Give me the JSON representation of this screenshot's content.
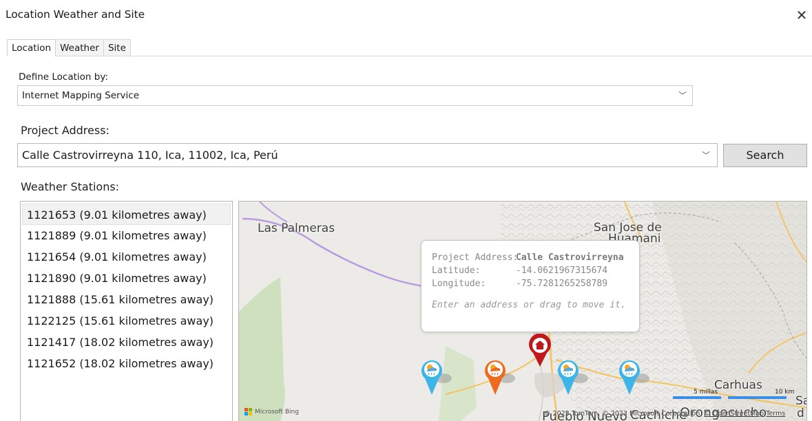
{
  "window": {
    "title": "Location Weather and Site",
    "close_glyph": "✕"
  },
  "tabs": [
    {
      "label": "Location",
      "active": true
    },
    {
      "label": "Weather",
      "active": false
    },
    {
      "label": "Site",
      "active": false
    }
  ],
  "define_location": {
    "label": "Define Location by:",
    "value": "Internet Mapping Service"
  },
  "project_address": {
    "label": "Project Address:",
    "value": "Calle Castrovirreyna 110, Ica, 11002, Ica, Perú"
  },
  "search_button": "Search",
  "weather_stations": {
    "label": "Weather Stations:",
    "items": [
      "1121653 (9.01 kilometres away)",
      "1121889 (9.01 kilometres away)",
      "1121654 (9.01 kilometres away)",
      "1121890 (9.01 kilometres away)",
      "1121888 (15.61 kilometres away)",
      "1122125 (15.61 kilometres away)",
      "1121417 (18.02 kilometres away)",
      "1121652 (18.02 kilometres away)"
    ],
    "selected_index": 0
  },
  "map": {
    "places": {
      "las_palmeras": "Las Palmeras",
      "san_jose_1": "San Jose de",
      "san_jose_2": "Huamani",
      "carhuas": "Carhuas",
      "orongocucho": "Orongocucho",
      "pueblo_nuevo": "Pueblo Nuevo",
      "cachiche": "Cachiche",
      "sa": "Sa",
      "d": "d"
    },
    "popup": {
      "address_key": "Project Address:",
      "address_value": "Calle Castrovirreyna",
      "lat_key": "Latitude:",
      "lat_value": "-14.0621967315674",
      "lon_key": "Longitude:",
      "lon_value": "-75.7281265258789",
      "hint": "Enter an address or drag to move it."
    },
    "attribution": "Microsoft Bing",
    "copyright_prefix": "© 2023 TomTom, © 2023 Microsoft Corporation, ",
    "copyright_osm": "© OpenStreetMap",
    "copyright_terms": "Terms",
    "scale_miles": "5 millas",
    "scale_km": "10 km",
    "colors": {
      "home_pin": "#c0191d",
      "station_pin": "#3db5e6",
      "selected_station_pin": "#ee6a1f",
      "road": "#b79be0",
      "highway": "#f2c35e",
      "vegetation": "#cfe0bf"
    },
    "icons": {
      "home_pin": "home-pin-icon",
      "station_pin": "weather-station-pin-icon"
    }
  }
}
